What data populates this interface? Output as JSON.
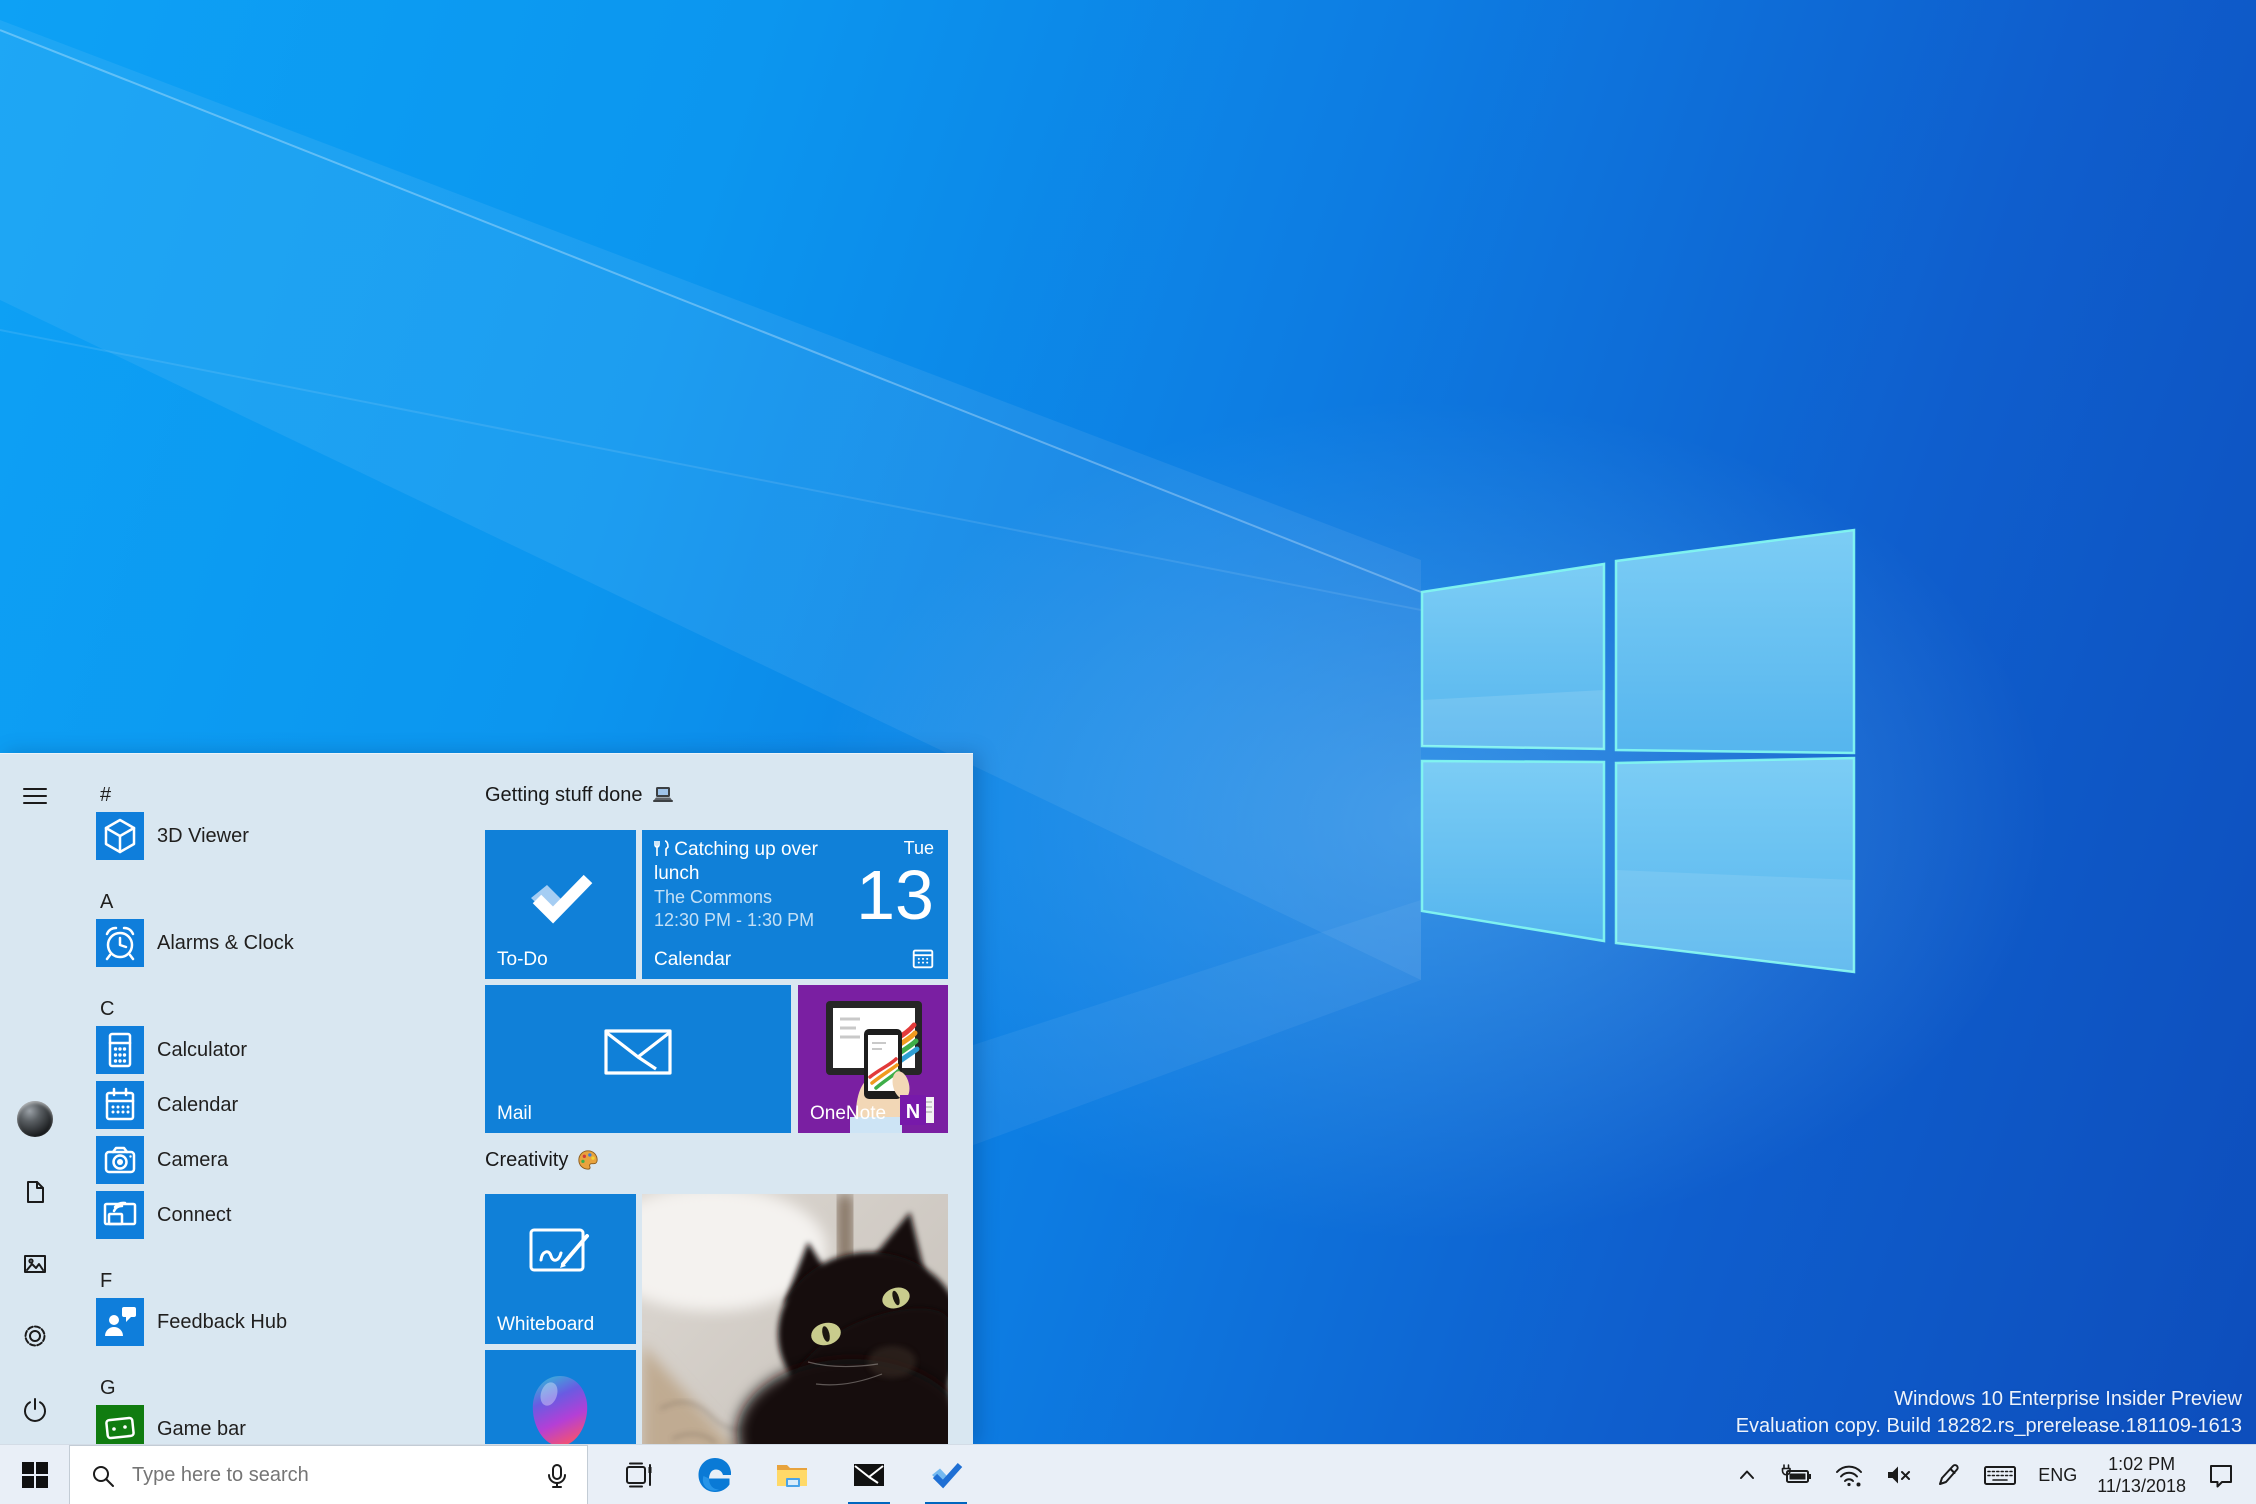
{
  "desktop": {
    "watermark": {
      "line1": "Windows 10 Enterprise Insider Preview",
      "line2": "Evaluation copy. Build 18282.rs_prerelease.181109-1613"
    }
  },
  "start_menu": {
    "app_list": [
      {
        "kind": "letter",
        "label": "#"
      },
      {
        "kind": "app",
        "label": "3D Viewer",
        "icon": "3d-viewer-icon"
      },
      {
        "kind": "letter",
        "label": "A"
      },
      {
        "kind": "app",
        "label": "Alarms & Clock",
        "icon": "alarms-clock-icon"
      },
      {
        "kind": "letter",
        "label": "C"
      },
      {
        "kind": "app",
        "label": "Calculator",
        "icon": "calculator-icon"
      },
      {
        "kind": "app",
        "label": "Calendar",
        "icon": "calendar-icon"
      },
      {
        "kind": "app",
        "label": "Camera",
        "icon": "camera-icon"
      },
      {
        "kind": "app",
        "label": "Connect",
        "icon": "connect-icon"
      },
      {
        "kind": "letter",
        "label": "F"
      },
      {
        "kind": "app",
        "label": "Feedback Hub",
        "icon": "feedback-hub-icon"
      },
      {
        "kind": "letter",
        "label": "G"
      },
      {
        "kind": "app",
        "label": "Game bar",
        "icon": "game-bar-icon"
      }
    ],
    "groups": [
      {
        "title": "Getting stuff done",
        "emoji": "💻"
      },
      {
        "title": "Creativity",
        "emoji": "🎨"
      }
    ],
    "tiles": {
      "todo": {
        "label": "To-Do"
      },
      "calendar": {
        "emoji": "🍴",
        "event": "Catching up over lunch",
        "location": "The Commons",
        "time": "12:30 PM - 1:30 PM",
        "weekday": "Tue",
        "day": "13",
        "label": "Calendar"
      },
      "mail": {
        "label": "Mail"
      },
      "onenote": {
        "label": "OneNote"
      },
      "whiteboard": {
        "label": "Whiteboard"
      }
    }
  },
  "taskbar": {
    "search": {
      "placeholder": "Type here to search"
    },
    "tray": {
      "language": "ENG",
      "time": "1:02 PM",
      "date": "11/13/2018"
    }
  },
  "colors": {
    "accent": "#0f7edb",
    "tile_blue": "#1080d8",
    "game_green": "#107c10",
    "onenote_purple": "#7a1fa2"
  }
}
